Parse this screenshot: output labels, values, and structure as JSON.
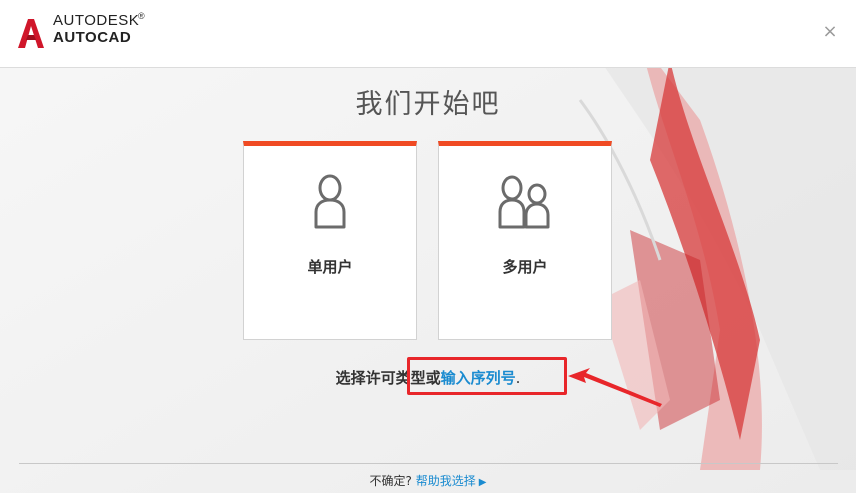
{
  "header": {
    "brand_line1": "AUTODESK",
    "brand_trademark": "®",
    "brand_line2": "AUTOCAD",
    "close_glyph": "×",
    "logo_icon": "autocad-a-logo-icon",
    "close_icon": "close-icon"
  },
  "main": {
    "title": "我们开始吧",
    "cards": [
      {
        "label": "单用户",
        "icon": "single-user-icon"
      },
      {
        "label": "多用户",
        "icon": "multi-user-icon"
      }
    ],
    "prompt_text": "选择许可类型或",
    "serial_link": "输入序列号",
    "prompt_end": "."
  },
  "footer": {
    "question": "不确定?",
    "help_link": "帮助我选择",
    "arrow_glyph": "▶"
  },
  "annotations": {
    "highlight_color": "#e8262a"
  },
  "colors": {
    "accent": "#f04a23",
    "link": "#1a8bd0",
    "brand_red": "#d0162a"
  }
}
